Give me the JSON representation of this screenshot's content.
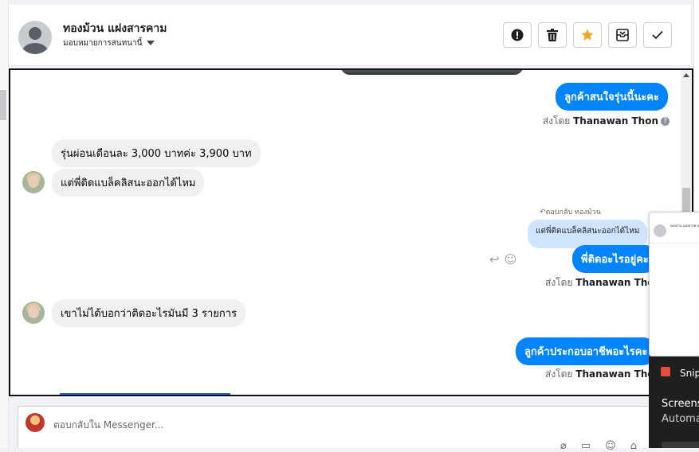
{
  "header": {
    "contact_name": "ทองม้วน แฝงสารคาม",
    "assign_label": "มอบหมายการสนทนานี้",
    "actions": [
      {
        "name": "spam-button",
        "icon": "alert-circle-icon"
      },
      {
        "name": "delete-button",
        "icon": "trash-icon"
      },
      {
        "name": "star-button",
        "icon": "star-icon"
      },
      {
        "name": "archive-button",
        "icon": "archive-icon"
      },
      {
        "name": "done-button",
        "icon": "check-icon"
      }
    ]
  },
  "messages": {
    "m1": {
      "text": "ลูกค้าสนใจรุ่นนี้นะคะ",
      "sent_by_prefix": "ส่งโดย",
      "sent_by_name": "Thanawan Thon"
    },
    "m2": {
      "text": "รุ่นผ่อนเดือนละ 3,000 บาทค่ะ 3,900 บาท"
    },
    "m3": {
      "text": "แต่พี่ติดแบล็คลิสนะออกได้ไหม"
    },
    "m4": {
      "reply_note": "ตอบกลับ ทองม้วน",
      "quoted": "แต่พี่ติดแบล็คลิสนะออกได้ไหม",
      "text": "พี่ติดอะไรอยู่คะ",
      "sent_by_prefix": "ส่งโดย",
      "sent_by_name": "Thanawan Thon"
    },
    "m5": {
      "text": "เขาไม่ได้บอกว่าติดอะไรมันมี 3 รายการ"
    },
    "m6": {
      "text": "ลูกค้าประกอบอาชีพอะไรคะ",
      "sent_by_prefix": "ส่งโดย",
      "sent_by_name": "Thanawan Thon"
    }
  },
  "composer": {
    "placeholder": "ตอบกลับใน Messenger..."
  },
  "snip": {
    "title": "Snip",
    "heading": "Screens",
    "subheading": "Automa"
  },
  "colors": {
    "outgoing_bubble": "#0084ff",
    "incoming_bubble": "#f0f0f0",
    "star_accent": "#f5a623"
  }
}
